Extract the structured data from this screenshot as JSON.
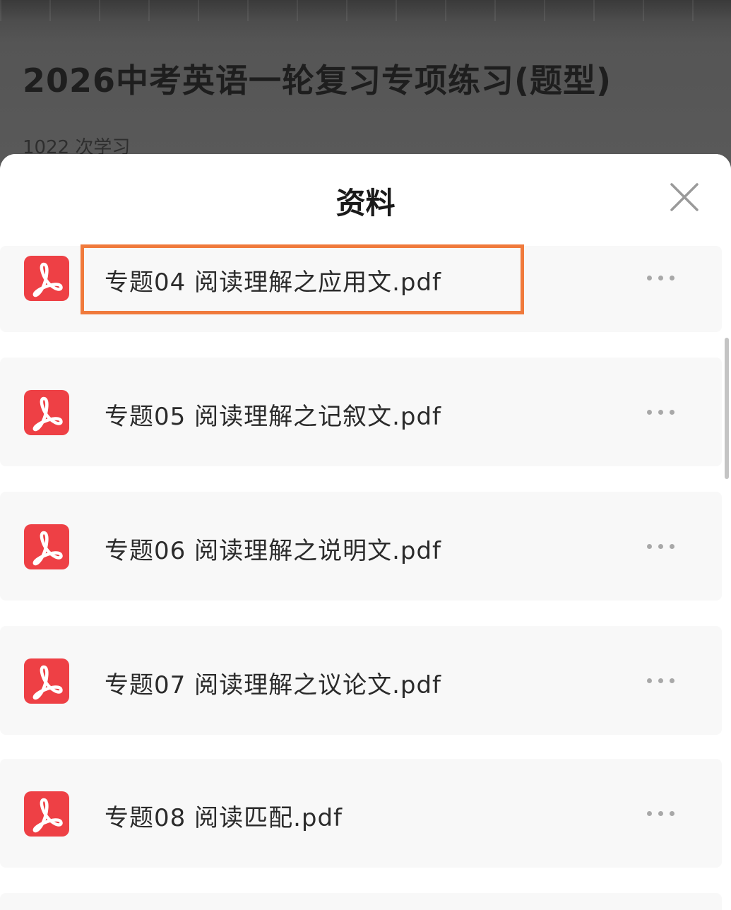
{
  "course": {
    "title": "2026中考英语一轮复习专项练习(题型)",
    "study_count": "1022 次学习"
  },
  "sheet": {
    "title": "资料",
    "close_icon": "close-icon"
  },
  "files": [
    {
      "name": "专题04 阅读理解之应用文.pdf",
      "icon": "pdf-icon",
      "highlighted": true
    },
    {
      "name": "专题05 阅读理解之记叙文.pdf",
      "icon": "pdf-icon",
      "highlighted": false
    },
    {
      "name": "专题06 阅读理解之说明文.pdf",
      "icon": "pdf-icon",
      "highlighted": false
    },
    {
      "name": "专题07 阅读理解之议论文.pdf",
      "icon": "pdf-icon",
      "highlighted": false
    },
    {
      "name": "专题08 阅读匹配.pdf",
      "icon": "pdf-icon",
      "highlighted": false
    }
  ],
  "colors": {
    "pdf_red": "#ee4045",
    "highlight_orange": "#f07a3c",
    "overlay_dim": "#4a4a4a"
  }
}
